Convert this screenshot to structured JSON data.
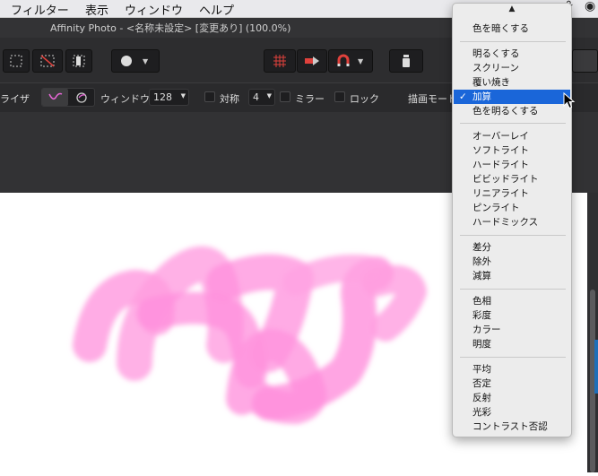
{
  "menubar": {
    "items": [
      "フィルター",
      "表示",
      "ウィンドウ",
      "ヘルプ"
    ]
  },
  "window": {
    "title": "Affinity Photo - <名称未設定> [変更あり] (100.0%)"
  },
  "context_toolbar": {
    "partial_label": "ライザ",
    "window_label": "ウィンドウ:",
    "window_value": "128",
    "symmetry_label": "対称",
    "symmetry_count": "4",
    "mirror_label": "ミラー",
    "lock_label": "ロック",
    "blend_mode_label": "描画モード"
  },
  "blend_menu": {
    "scroll_up_arrow": "▲",
    "groups": [
      {
        "items": [
          "色を暗くする"
        ]
      },
      {
        "items": [
          "明るくする",
          "スクリーン",
          "覆い焼き",
          "加算",
          "色を明るくする"
        ]
      },
      {
        "items": [
          "オーバーレイ",
          "ソフトライト",
          "ハードライト",
          "ビビッドライト",
          "リニアライト",
          "ピンライト",
          "ハードミックス"
        ]
      },
      {
        "items": [
          "差分",
          "除外",
          "減算"
        ]
      },
      {
        "items": [
          "色相",
          "彩度",
          "カラー",
          "明度"
        ]
      },
      {
        "items": [
          "平均",
          "否定",
          "反射",
          "光彩",
          "コントラスト否認"
        ]
      }
    ],
    "selected": "加算",
    "check_mark": "✓"
  },
  "colors": {
    "highlight": "#1a66d9",
    "stroke_pink": "#ff8fdc",
    "ui_dark": "#2d2d2f"
  }
}
